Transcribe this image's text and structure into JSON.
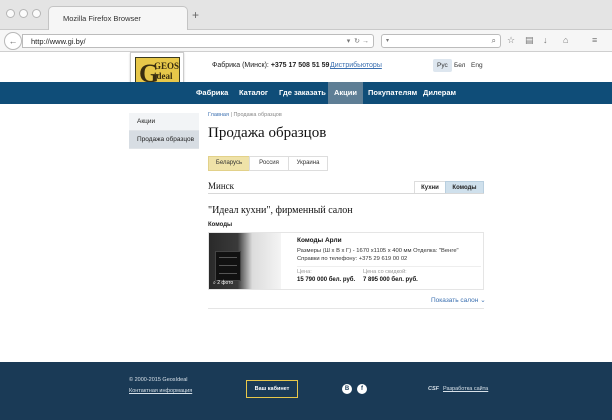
{
  "browser": {
    "tab_title": "Mozilla Firefox Browser",
    "new_tab": "+",
    "url": "http://www.gi.by/"
  },
  "header": {
    "logo_g": "G",
    "logo_geos": "GEOS",
    "logo_ideal": "ideal",
    "phone_label": "Фабрика (Минск): ",
    "phone_number": "+375 17 508 51 59",
    "distributors": "Дистрибьюторы",
    "languages": [
      "Рус",
      "Бел",
      "Eng"
    ],
    "active_language": "Рус"
  },
  "nav": {
    "items": [
      "Фабрика",
      "Каталог",
      "Где заказать",
      "Акции",
      "Покупателям",
      "Дилерам"
    ],
    "active": "Акции"
  },
  "sidebar": {
    "items": [
      "Акции",
      "Продажа образцов"
    ],
    "active": "Продажа образцов"
  },
  "breadcrumb": {
    "home": "Главная",
    "separator": "|",
    "current": "Продажа образцов"
  },
  "page_title": "Продажа образцов",
  "countries": {
    "items": [
      "Беларусь",
      "Россия",
      "Украина"
    ],
    "active": "Беларусь"
  },
  "city": "Минск",
  "categories": {
    "items": [
      "Кухни",
      "Комоды"
    ],
    "active": "Комоды"
  },
  "salon_title": "\"Идеал кухни\", фирменный салон",
  "section_label": "Комоды",
  "product": {
    "photo_count": "2 фото",
    "name": "Комоды Арли",
    "description": "Размеры (Ш x В x Г) - 1670 х1105 х 400 мм Отделка: \"Венге\" Справки по телефону: +375 29 619 00 02",
    "price_label": "Цена:",
    "price": "15 790 000 бел. руб.",
    "discount_label": "Цена со скидкой:",
    "discount_price": "7 895 000 бел. руб."
  },
  "show_salon": "Показать салон",
  "footer": {
    "copyright": "© 2000-2015 GeosIdeal",
    "contact": "Контактная информация",
    "cabinet": "Ваш кабинет",
    "social_b": "В",
    "social_f": "f",
    "csf": "CSF",
    "developer": "Разработка сайта"
  },
  "colors": {
    "nav_bg": "#0f4d78",
    "footer_bg": "#1a3a56",
    "accent_yellow": "#e8c84a",
    "link": "#3a6fb0"
  }
}
